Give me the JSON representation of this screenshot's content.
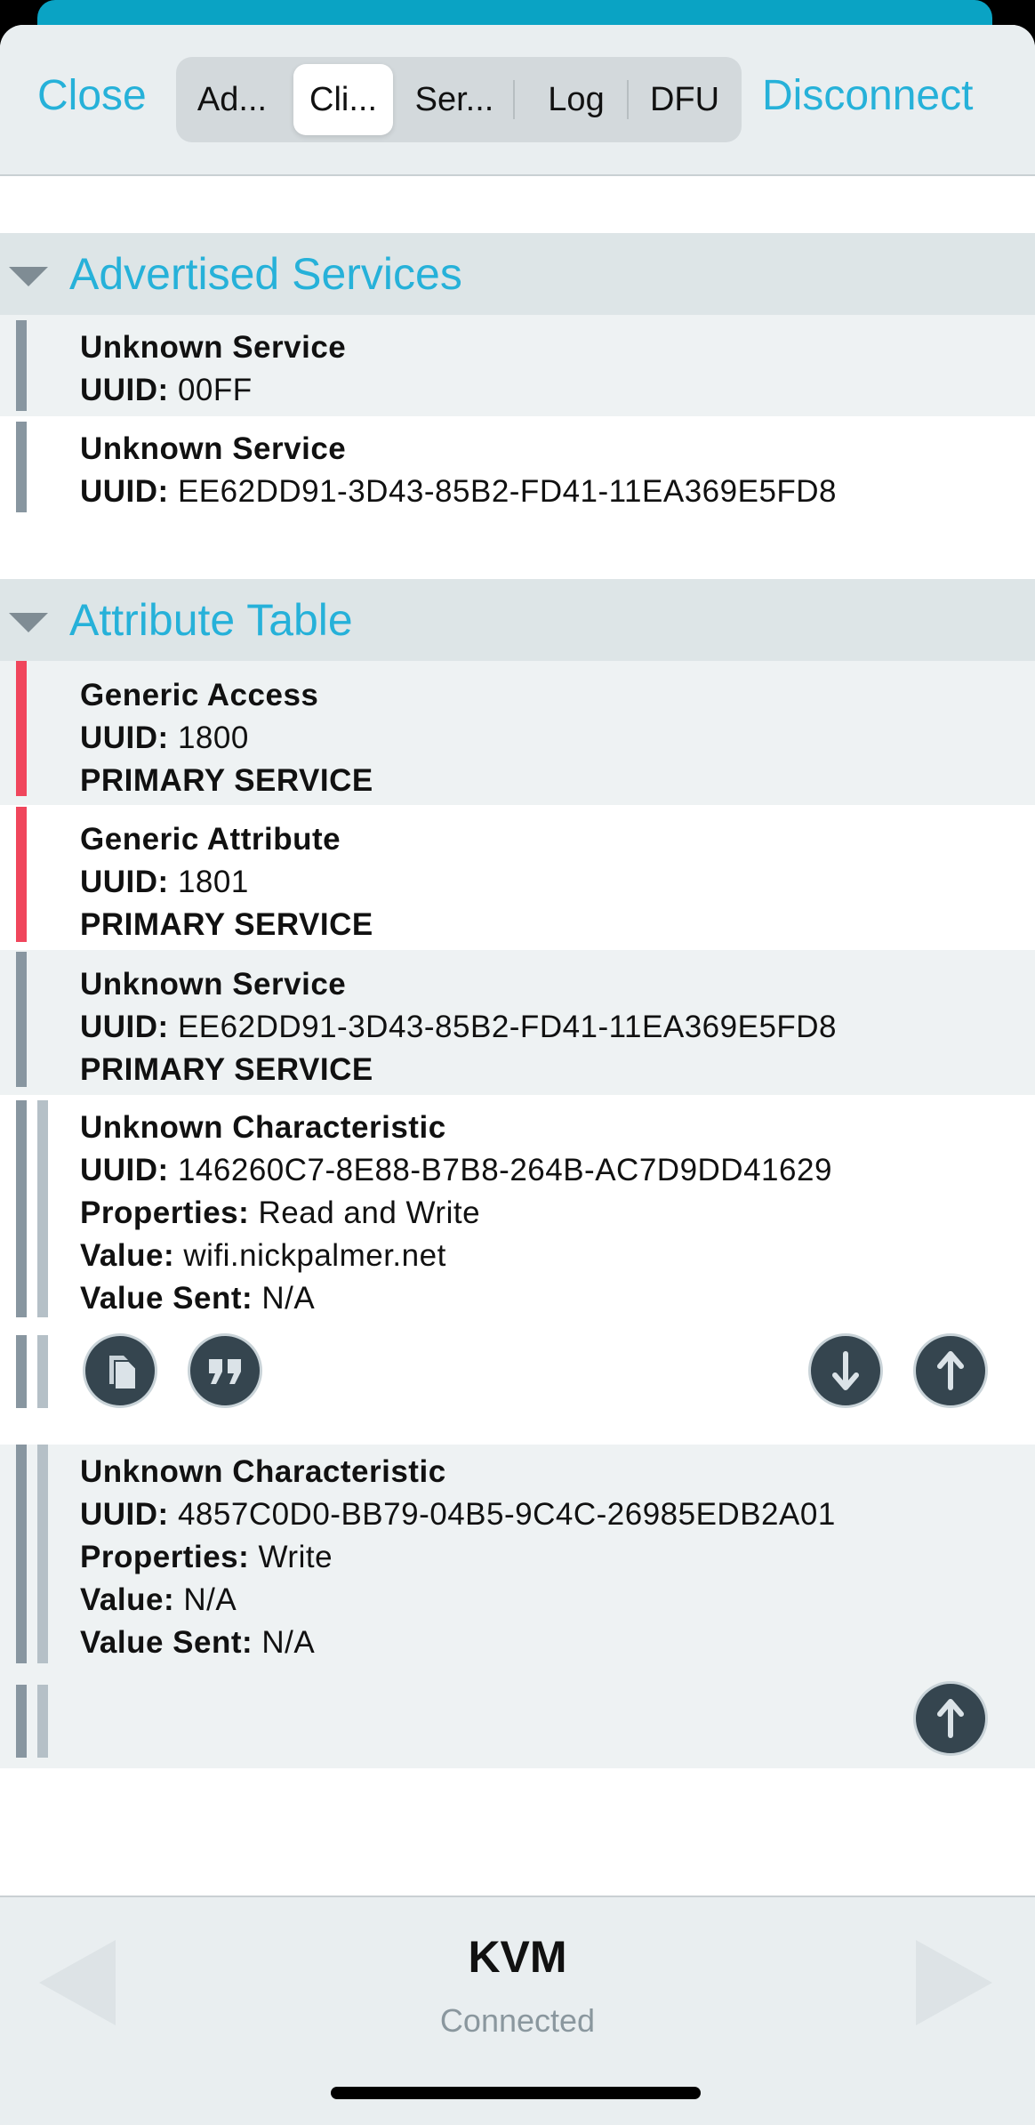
{
  "header": {
    "close_label": "Close",
    "disconnect_label": "Disconnect",
    "tabs": [
      {
        "label": "Ad..."
      },
      {
        "label": "Cli..."
      },
      {
        "label": "Ser..."
      },
      {
        "label": "Log"
      },
      {
        "label": "DFU"
      }
    ],
    "active_tab": "Cli..."
  },
  "advertised": {
    "title": "Advertised Services",
    "items": [
      {
        "name": "Unknown Service",
        "uuid_label": "UUID:",
        "uuid": "00FF"
      },
      {
        "name": "Unknown Service",
        "uuid_label": "UUID:",
        "uuid": "EE62DD91-3D43-85B2-FD41-11EA369E5FD8"
      }
    ]
  },
  "attributes": {
    "title": "Attribute Table",
    "services": [
      {
        "name": "Generic Access",
        "uuid_label": "UUID:",
        "uuid": "1800",
        "kind": "PRIMARY SERVICE"
      },
      {
        "name": "Generic Attribute",
        "uuid_label": "UUID:",
        "uuid": "1801",
        "kind": "PRIMARY SERVICE"
      },
      {
        "name": "Unknown Service",
        "uuid_label": "UUID:",
        "uuid": "EE62DD91-3D43-85B2-FD41-11EA369E5FD8",
        "kind": "PRIMARY SERVICE"
      }
    ],
    "characteristics": [
      {
        "name": "Unknown Characteristic",
        "uuid_label": "UUID:",
        "uuid": "146260C7-8E88-B7B8-264B-AC7D9DD41629",
        "properties_label": "Properties:",
        "properties": "Read and Write",
        "value_label": "Value:",
        "value": "wifi.nickpalmer.net",
        "value_sent_label": "Value Sent:",
        "value_sent": "N/A"
      },
      {
        "name": "Unknown Characteristic",
        "uuid_label": "UUID:",
        "uuid": "4857C0D0-BB79-04B5-9C4C-26985EDB2A01",
        "properties_label": "Properties:",
        "properties": "Write",
        "value_label": "Value:",
        "value": "N/A",
        "value_sent_label": "Value Sent:",
        "value_sent": "N/A"
      }
    ]
  },
  "footer": {
    "device_name": "KVM",
    "status": "Connected"
  },
  "colors": {
    "accent": "#26b1d9",
    "teal_strip": "#0aa3c4",
    "system_service_bar": "#f0465c",
    "custom_service_bar": "#8896a0",
    "button_fill": "#35454f"
  },
  "icons": [
    "copy-icon",
    "quote-icon",
    "download-arrow-icon",
    "upload-arrow-icon",
    "back-arrow-icon",
    "forward-arrow-icon"
  ]
}
